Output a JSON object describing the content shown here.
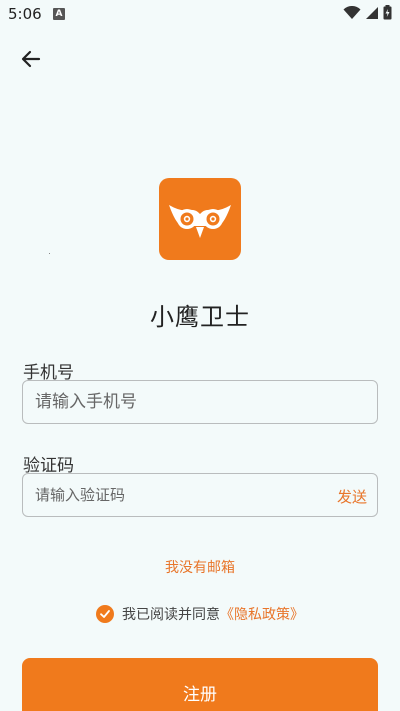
{
  "status_bar": {
    "time": "5:06",
    "notification_badge": "A",
    "icons": [
      "wifi-icon",
      "signal-icon",
      "battery-icon"
    ]
  },
  "header": {
    "back_icon": "arrow-left-icon"
  },
  "app": {
    "name": "小鹰卫士",
    "logo_icon": "owl-logo-icon",
    "brand_color": "#f07a1c"
  },
  "form": {
    "phone_label": "手机号",
    "phone_placeholder": "请输入手机号",
    "phone_value": "",
    "code_label": "验证码",
    "code_placeholder": "请输入验证码",
    "code_value": "",
    "send_label": "发送"
  },
  "no_email_link": "我没有邮箱",
  "agreement": {
    "checked": true,
    "text": "我已阅读并同意",
    "privacy_link": "《隐私政策》"
  },
  "register_label": "注册"
}
